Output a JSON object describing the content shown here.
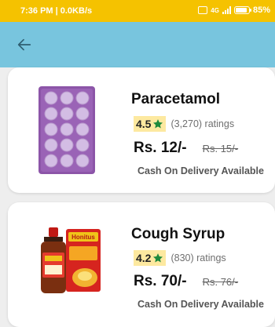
{
  "status_bar": {
    "time_network": "7:36 PM | 0.0KB/s",
    "signal_label": "4G",
    "battery_percent": "85%",
    "battery_level": 0.85
  },
  "app_bar": {
    "background": "#78c5de",
    "back_icon": "arrow-left-icon"
  },
  "products": [
    {
      "name": "Paracetamol",
      "rating": "4.5",
      "rating_count": "(3,270) ratings",
      "price": "Rs. 12/-",
      "mrp": "Rs. 15/-",
      "delivery_note": "Cash On Delivery Available",
      "image_icon": "tablet-blister-image"
    },
    {
      "name": "Cough Syrup",
      "rating": "4.2",
      "rating_count": "(830) ratings",
      "price": "Rs. 70/-",
      "mrp": "Rs. 76/-",
      "delivery_note": "Cash On Delivery Available",
      "image_icon": "syrup-bottle-image",
      "image_brand_text": "Honitus"
    }
  ],
  "colors": {
    "status_bar": "#f5c200",
    "rating_highlight": "#fde9a0",
    "star": "#1e8a3c"
  }
}
